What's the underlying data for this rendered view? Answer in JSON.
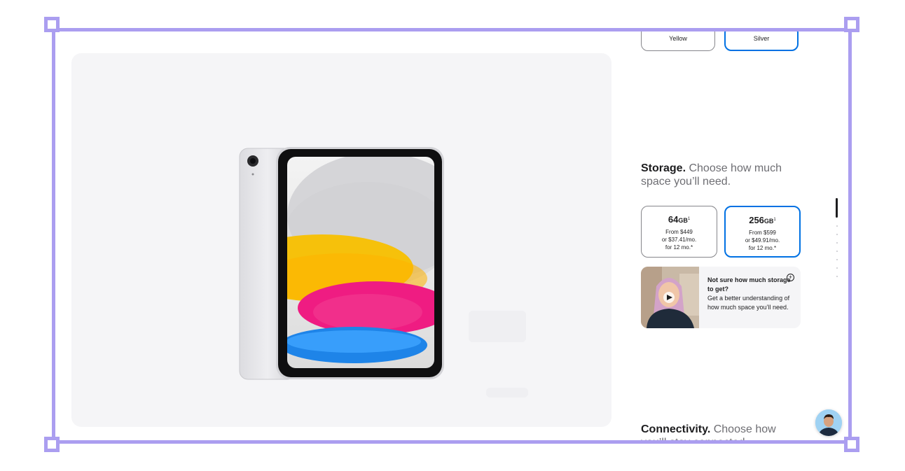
{
  "colors": {
    "options": [
      {
        "label": "Yellow",
        "selected": false
      },
      {
        "label": "Silver",
        "selected": true
      }
    ]
  },
  "storage": {
    "heading_em": "Storage.",
    "heading_rest": " Choose how much space you’ll need.",
    "options": [
      {
        "capacity": "64",
        "unit": "GB",
        "footnote": "1",
        "price": "From $449",
        "monthly": "or $37.41/mo.",
        "term": "for 12 mo.*",
        "selected": false
      },
      {
        "capacity": "256",
        "unit": "GB",
        "footnote": "1",
        "price": "From $599",
        "monthly": "or $49.91/mo.",
        "term": "for 12 mo.*",
        "selected": true
      }
    ]
  },
  "help_card": {
    "title": "Not sure how much storage to get?",
    "body": "Get a better understanding of how much space you’ll need.",
    "icon": "plus-circle-icon"
  },
  "connectivity": {
    "heading_em": "Connectivity.",
    "heading_rest": " Choose how you’ll stay connected."
  },
  "gallery": {
    "image": "ipad-silver-front"
  },
  "accent_color": "#0071e3",
  "frame_color": "#ab9ef0"
}
